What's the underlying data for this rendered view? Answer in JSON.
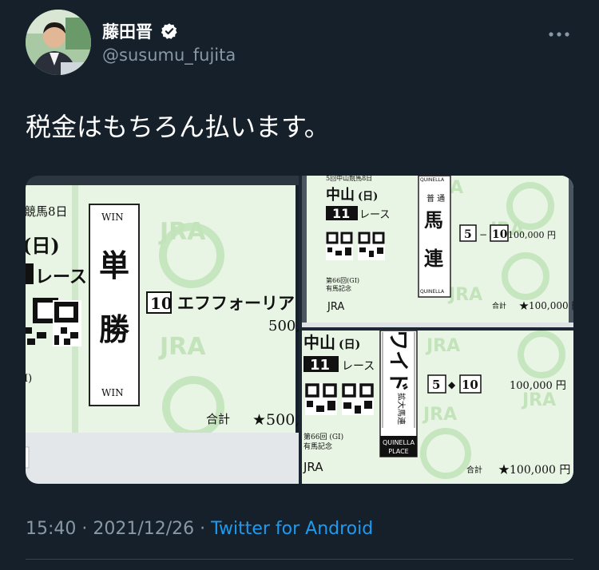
{
  "user": {
    "display_name": "藤田晋",
    "handle": "@susumu_fujita",
    "more_icon": "more-horizontal-icon",
    "verified_icon": "verified-badge-icon"
  },
  "tweet": {
    "text": "税金はもちろん払います。"
  },
  "footer": {
    "time": "15:40 · 2021/12/26 · ",
    "source": "Twitter for Android"
  },
  "ticket1": {
    "header": "競馬8日",
    "day": "(日)",
    "race_suffix": "レース",
    "bet_en_top": "WIN",
    "bet_jp_1": "単",
    "bet_jp_2": "勝",
    "bet_en_bottom": "WIN",
    "horse_num": "10",
    "horse_name": "エフフォーリア",
    "amount": "500,",
    "total_label": "合計",
    "total": "★500,",
    "watermark": "JRA"
  },
  "ticket2": {
    "header": "5回中山競馬8日",
    "venue": "中山",
    "day": "(日)",
    "race_num": "11",
    "race_suffix": "レース",
    "bet_en_top": "QUINELLA",
    "bet_sub": "普 通",
    "bet_jp_1": "馬",
    "bet_jp_2": "連",
    "bet_en_bottom": "QUINELLA",
    "combo_a": "5",
    "combo_sep": "−",
    "combo_b": "10",
    "amount": "100,000 円",
    "race_edition": "第66回(GI)",
    "race_title": "有馬記念",
    "brand": "JRA",
    "total_label": "合計",
    "total": "★100,000 円",
    "watermark": "JRA"
  },
  "ticket3": {
    "venue": "中山",
    "day": "(日)",
    "race_num": "11",
    "race_suffix": "レース",
    "bet_jp": "ワイド",
    "bet_sub": "拡大馬連",
    "bet_en_1": "QUINELLA",
    "bet_en_2": "PLACE",
    "combo_a": "5",
    "combo_sep": "◆",
    "combo_b": "10",
    "amount": "100,000 円",
    "race_edition": "第66回 (GI)",
    "race_title": "有馬記念",
    "brand": "JRA",
    "total_label": "合計",
    "total": "★100,000 円",
    "watermark": "JRA"
  }
}
